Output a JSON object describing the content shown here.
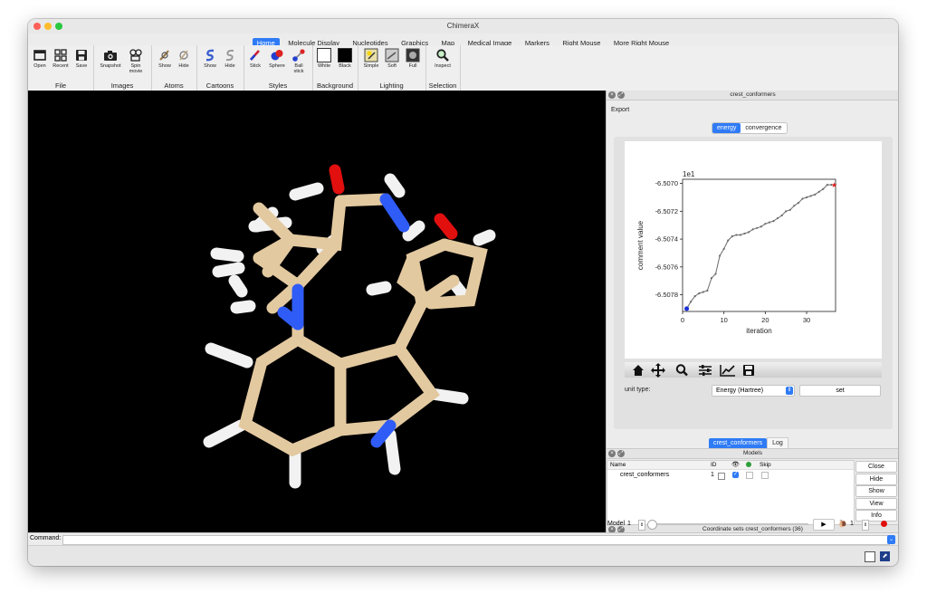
{
  "window": {
    "title": "ChimeraX"
  },
  "ribbon_tabs": [
    "Home",
    "Molecule Display",
    "Nucleotides",
    "Graphics",
    "Map",
    "Medical Image",
    "Markers",
    "Right Mouse",
    "More Right Mouse"
  ],
  "toolbar": {
    "file": {
      "label": "File",
      "open": "Open",
      "recent": "Recent",
      "save": "Save"
    },
    "images": {
      "label": "Images",
      "snapshot": "Snapshot",
      "spin": "Spin\nmovie"
    },
    "atoms": {
      "label": "Atoms",
      "show": "Show",
      "hide": "Hide"
    },
    "cartoons": {
      "label": "Cartoons",
      "show": "Show",
      "hide": "Hide"
    },
    "styles": {
      "label": "Styles",
      "stick": "Stick",
      "sphere": "Sphere",
      "ball": "Ball\nstick"
    },
    "background": {
      "label": "Background",
      "white": "White",
      "black": "Black"
    },
    "lighting": {
      "label": "Lighting",
      "simple": "Simple",
      "soft": "Soft",
      "full": "Full"
    },
    "selection": {
      "label": "Selection",
      "inspect": "Inspect"
    }
  },
  "crest_panel": {
    "title": "crest_conformers",
    "export": "Export",
    "tabs": [
      "energy",
      "convergence"
    ],
    "active_tab": "energy",
    "unit_type_label": "unit type:",
    "unit_type_value": "Energy (Hartree)",
    "set_button": "set"
  },
  "chart_data": {
    "type": "line",
    "title": "",
    "offset_label": "1e1",
    "xlabel": "iteration",
    "ylabel": "comment value",
    "xlim": [
      0,
      37
    ],
    "ylim": [
      -6.50792,
      -6.50697
    ],
    "xticks": [
      0,
      10,
      20,
      30
    ],
    "yticks": [
      -6.507,
      -6.5072,
      -6.5074,
      -6.5076,
      -6.5078
    ],
    "ytick_labels": [
      "-6.5070",
      "-6.5072",
      "-6.5074",
      "-6.5076",
      "-6.5078"
    ],
    "x": [
      1,
      2,
      3,
      4,
      5,
      6,
      7,
      8,
      9,
      10,
      11,
      12,
      13,
      14,
      15,
      16,
      17,
      18,
      19,
      20,
      21,
      22,
      23,
      24,
      25,
      26,
      27,
      28,
      29,
      30,
      31,
      32,
      33,
      34,
      35,
      36
    ],
    "values": [
      -6.5079,
      -6.50785,
      -6.50781,
      -6.50779,
      -6.50778,
      -6.50777,
      -6.50768,
      -6.50765,
      -6.50752,
      -6.50747,
      -6.50741,
      -6.50738,
      -6.50737,
      -6.50737,
      -6.50736,
      -6.50735,
      -6.50733,
      -6.50732,
      -6.50731,
      -6.50729,
      -6.50728,
      -6.50727,
      -6.50725,
      -6.50723,
      -6.5072,
      -6.50719,
      -6.50716,
      -6.50714,
      -6.50711,
      -6.5071,
      -6.50709,
      -6.50708,
      -6.50706,
      -6.50704,
      -6.50701,
      -6.50701
    ],
    "line_color": "#6b6b6b",
    "start_marker_color": "#1a2fd6",
    "end_marker_color": "#e01b1b"
  },
  "plot_toolbar": {
    "icons": [
      "home-icon",
      "move-icon",
      "zoom-icon",
      "configure-icon",
      "edit-axis-icon",
      "save-icon"
    ]
  },
  "dock_tabs": [
    "crest_conformers",
    "Log"
  ],
  "dock_active": "crest_conformers",
  "models_panel": {
    "title": "Models",
    "columns": {
      "name": "Name",
      "id": "ID",
      "skip": "Skip"
    },
    "rows": [
      {
        "name": "crest_conformers",
        "id": "1"
      }
    ],
    "buttons": [
      "Close",
      "Hide",
      "Show",
      "View",
      "Info"
    ]
  },
  "coord_panel": {
    "title": "Coordinate sets crest_conformers (36)",
    "model_label": "Model",
    "model_value": "1",
    "step_value": "1"
  },
  "command": {
    "label": "Command:",
    "value": ""
  },
  "colors": {
    "accent": "#2f7bf6",
    "viewport": "#000000",
    "carbon": "#e3c9a0",
    "nitrogen": "#2f5cf7",
    "oxygen": "#e20f0f",
    "hydrogen": "#ffffff"
  }
}
